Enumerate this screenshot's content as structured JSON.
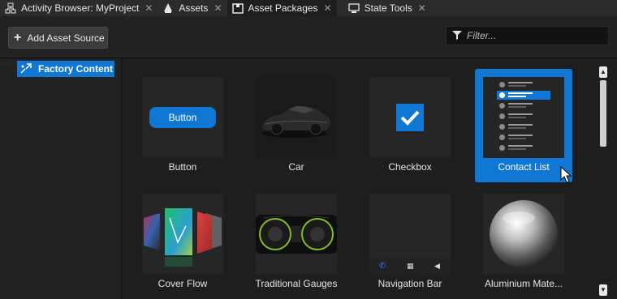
{
  "tabs": [
    {
      "label": "Activity Browser: MyProject",
      "icon": "activity-browser-icon",
      "active": false,
      "closable": true
    },
    {
      "label": "Assets",
      "icon": "assets-icon",
      "active": false,
      "closable": true
    },
    {
      "label": "Asset Packages",
      "icon": "asset-packages-icon",
      "active": true,
      "closable": true
    },
    {
      "label": "State Tools",
      "icon": "state-tools-icon",
      "active": false,
      "closable": true
    }
  ],
  "toolbar": {
    "add_label": "Add Asset Source",
    "filter_placeholder": "Filter..."
  },
  "tree": {
    "items": [
      {
        "label": "Factory Content",
        "selected": true
      }
    ]
  },
  "assets": [
    {
      "label": "Button",
      "selected": false
    },
    {
      "label": "Car",
      "selected": false
    },
    {
      "label": "Checkbox",
      "selected": false
    },
    {
      "label": "Contact List",
      "selected": true
    },
    {
      "label": "Cover Flow",
      "selected": false
    },
    {
      "label": "Traditional Gauges",
      "selected": false
    },
    {
      "label": "Navigation Bar",
      "selected": false
    },
    {
      "label": "Aluminium Mate...",
      "selected": false
    }
  ],
  "thumbs": {
    "button_text": "Button"
  },
  "colors": {
    "accent": "#1177d4",
    "background": "#1e1e1e",
    "panel": "#222222",
    "tabbar": "#2b2b2b"
  }
}
